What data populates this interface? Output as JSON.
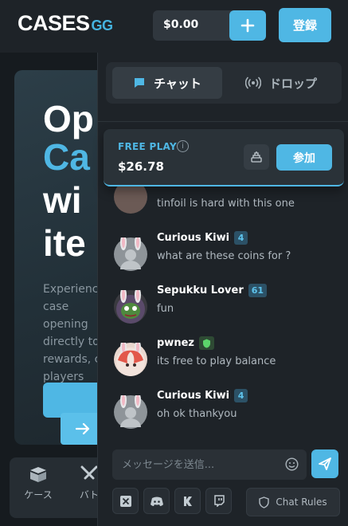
{
  "header": {
    "logo_main": "CASES",
    "logo_suffix": "GG",
    "balance": "$0.00",
    "register_label": "登録"
  },
  "background": {
    "hero_lines": [
      "Op",
      "Ca",
      "wi",
      "ite"
    ],
    "hero_text": "Experience case opening directly to rewards, c players",
    "bottom_tabs": [
      {
        "label": "ケース",
        "icon": "box-icon"
      },
      {
        "label": "バト",
        "icon": "swords-icon"
      }
    ]
  },
  "chat": {
    "tabs": [
      {
        "label": "チャット",
        "icon": "chat-bubble-icon"
      },
      {
        "label": "ドロップ",
        "icon": "broadcast-icon"
      }
    ],
    "free_play": {
      "label": "FREE PLAY",
      "info": "i",
      "amount": "$26.78",
      "join_label": "参加"
    },
    "partial_message": "tinfoil is hard with this one",
    "messages": [
      {
        "name": "Curious Kiwi",
        "level": "4",
        "text": "what are these coins for ?"
      },
      {
        "name": "Sepukku Lover",
        "level": "61",
        "text": "fun"
      },
      {
        "name": "pwnez",
        "level": "",
        "text": "its free to play balance"
      },
      {
        "name": "Curious Kiwi",
        "level": "4",
        "text": "oh ok thankyou"
      }
    ],
    "input_placeholder": "メッセージを送信...",
    "social": [
      "X",
      "Discord",
      "K",
      "Twitch"
    ],
    "rules_label": "Chat Rules"
  },
  "colors": {
    "accent": "#4fb7e4",
    "background": "#1b2024",
    "panel": "#1e2328"
  }
}
